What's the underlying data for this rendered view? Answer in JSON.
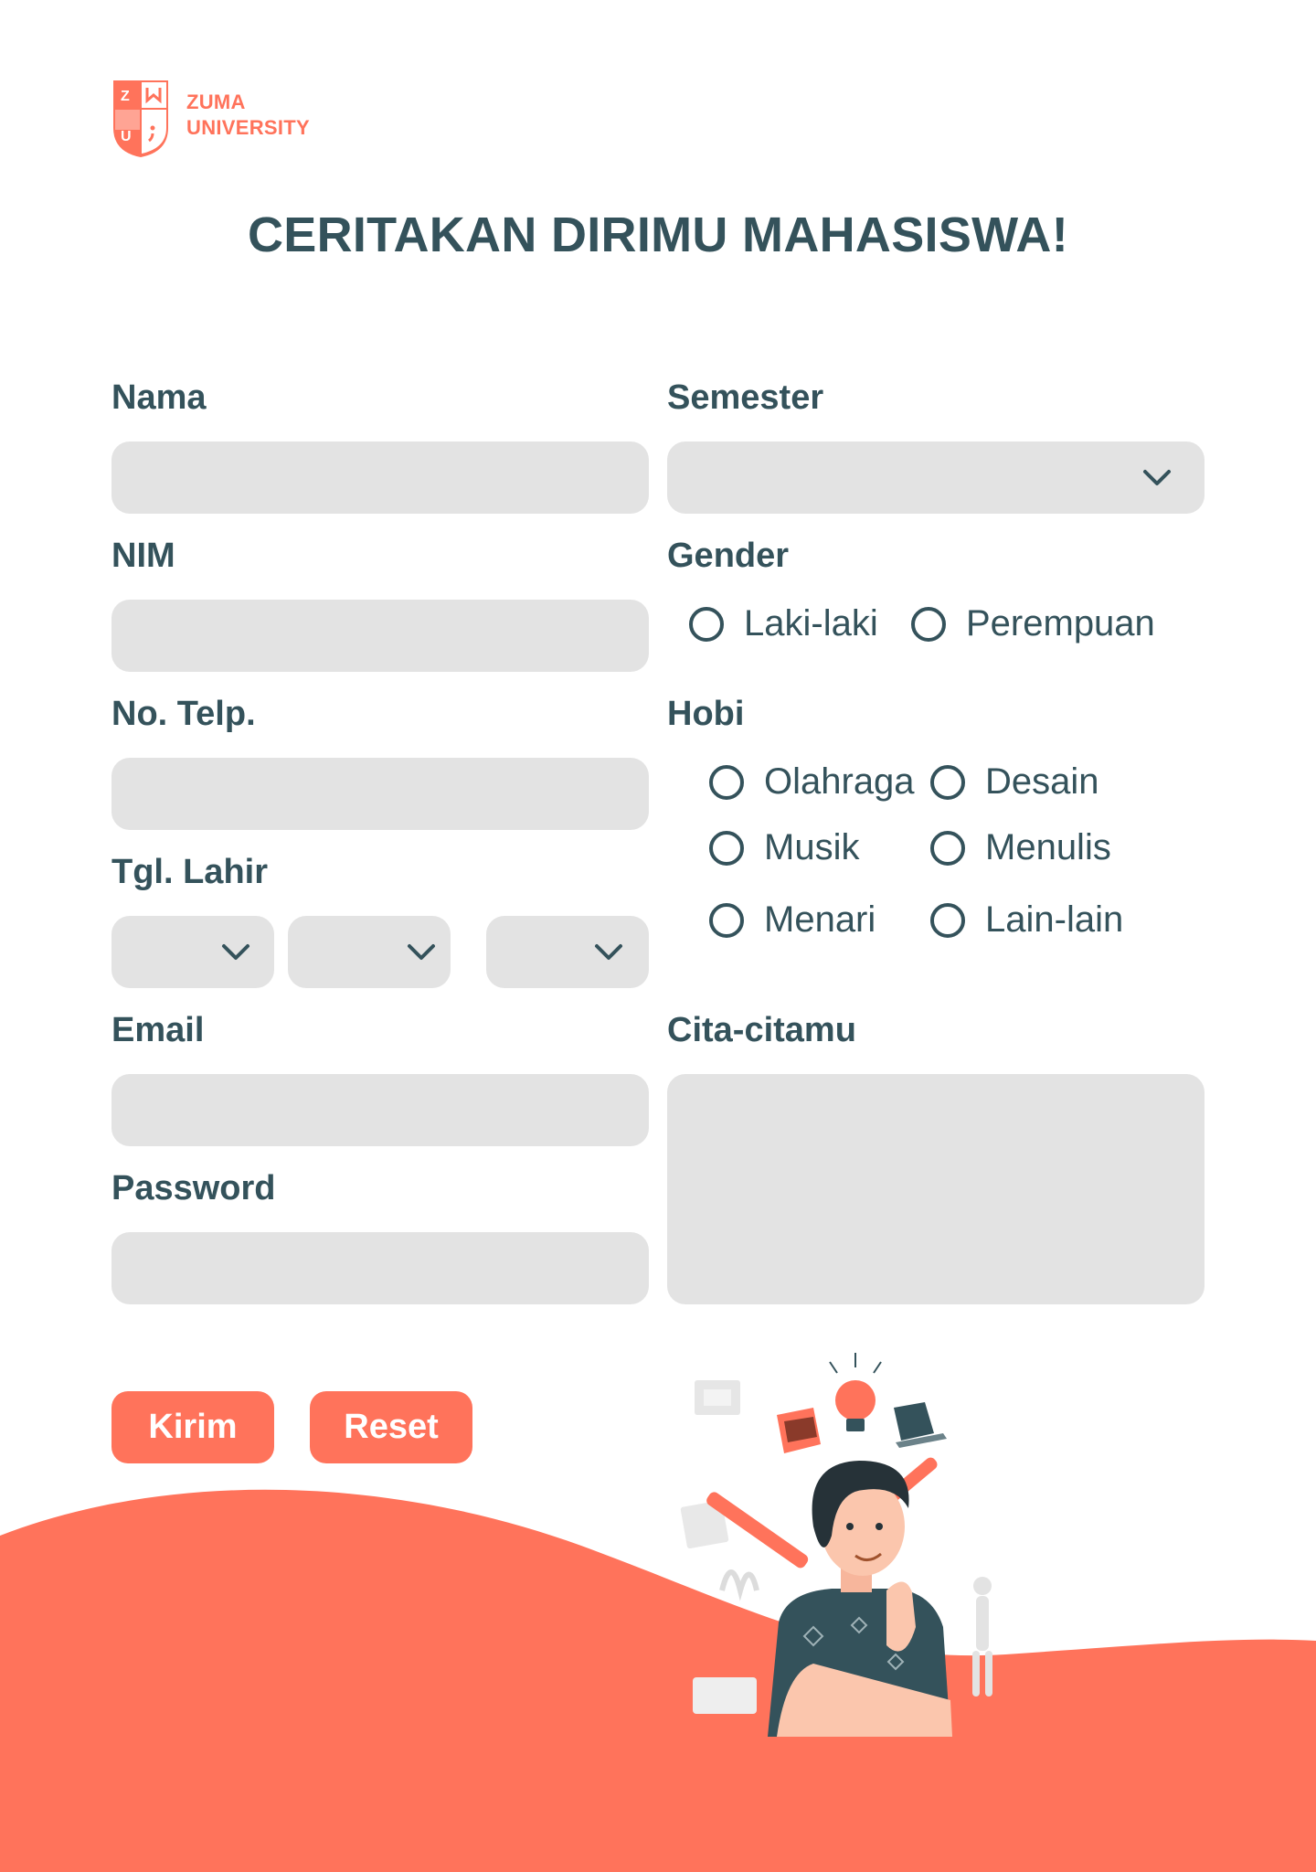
{
  "brand": {
    "line1": "ZUMA",
    "line2": "UNIVERSITY",
    "shield_letters": [
      "Z",
      "U"
    ]
  },
  "page_title": "CERITAKAN DIRIMU MAHASISWA!",
  "fields": {
    "nama": {
      "label": "Nama",
      "value": ""
    },
    "nim": {
      "label": "NIM",
      "value": ""
    },
    "telp": {
      "label": "No. Telp.",
      "value": ""
    },
    "tgl_lahir": {
      "label": "Tgl. Lahir"
    },
    "email": {
      "label": "Email",
      "value": ""
    },
    "password": {
      "label": "Password",
      "value": ""
    },
    "semester": {
      "label": "Semester",
      "value": ""
    },
    "gender": {
      "label": "Gender",
      "options": [
        "Laki-laki",
        "Perempuan"
      ]
    },
    "hobi": {
      "label": "Hobi",
      "options": [
        "Olahraga",
        "Desain",
        "Musik",
        "Menulis",
        "Menari",
        "Lain-lain"
      ]
    },
    "cita": {
      "label": "Cita-citamu",
      "value": ""
    }
  },
  "buttons": {
    "submit": "Kirim",
    "reset": "Reset"
  },
  "colors": {
    "accent": "#ff735b",
    "text": "#34525b",
    "field_bg": "#e3e3e3"
  },
  "icons": [
    "chevron-down-icon",
    "radio-icon",
    "shield-logo-icon"
  ]
}
